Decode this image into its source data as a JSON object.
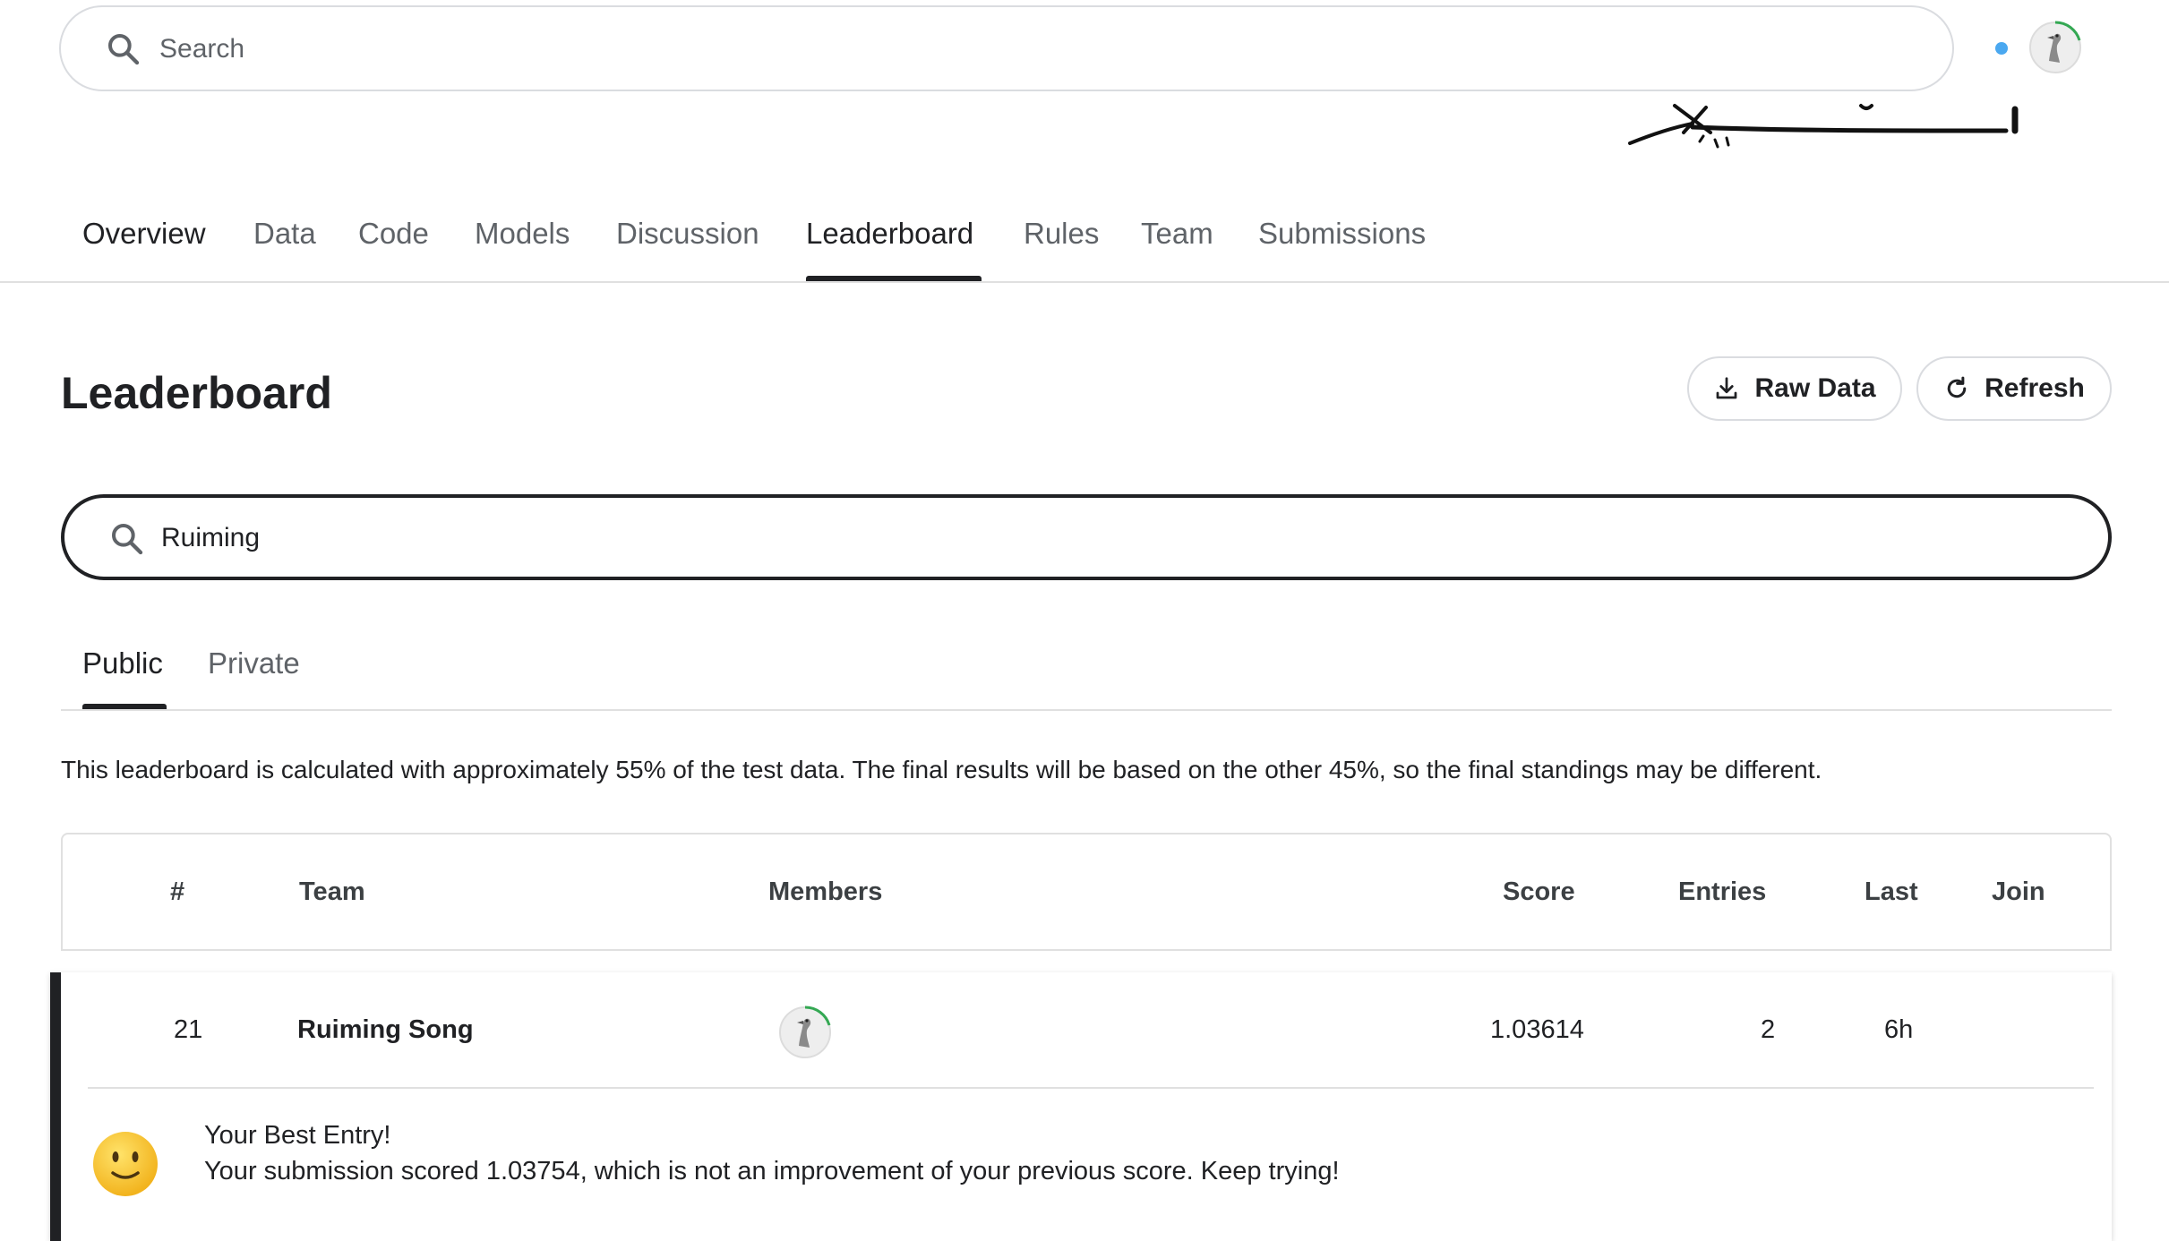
{
  "header": {
    "search_placeholder": "Search"
  },
  "nav": {
    "tabs": [
      {
        "label": "Overview"
      },
      {
        "label": "Data"
      },
      {
        "label": "Code"
      },
      {
        "label": "Models"
      },
      {
        "label": "Discussion"
      },
      {
        "label": "Leaderboard",
        "active": true
      },
      {
        "label": "Rules"
      },
      {
        "label": "Team"
      },
      {
        "label": "Submissions"
      }
    ]
  },
  "page": {
    "title": "Leaderboard",
    "raw_data_label": "Raw Data",
    "refresh_label": "Refresh"
  },
  "leaderboard_search": {
    "value": "Ruiming"
  },
  "subtabs": [
    {
      "label": "Public",
      "active": true
    },
    {
      "label": "Private"
    }
  ],
  "notice": "This leaderboard is calculated with approximately 55% of the test data. The final results will be based on the other 45%, so the final standings may be different.",
  "table": {
    "columns": [
      "#",
      "Team",
      "Members",
      "Score",
      "Entries",
      "Last",
      "Join"
    ],
    "rows": [
      {
        "rank": "21",
        "team": "Ruiming Song",
        "score": "1.03614",
        "entries": "2",
        "last": "6h",
        "join": ""
      }
    ]
  },
  "best_entry": {
    "title": "Your Best Entry!",
    "message": "Your submission scored 1.03754, which is not an improvement of your previous score. Keep trying!"
  },
  "colors": {
    "accent": "#202124",
    "notification": "#4aa8f0",
    "progress_ring": "#34a853",
    "border": "#dadce0"
  }
}
